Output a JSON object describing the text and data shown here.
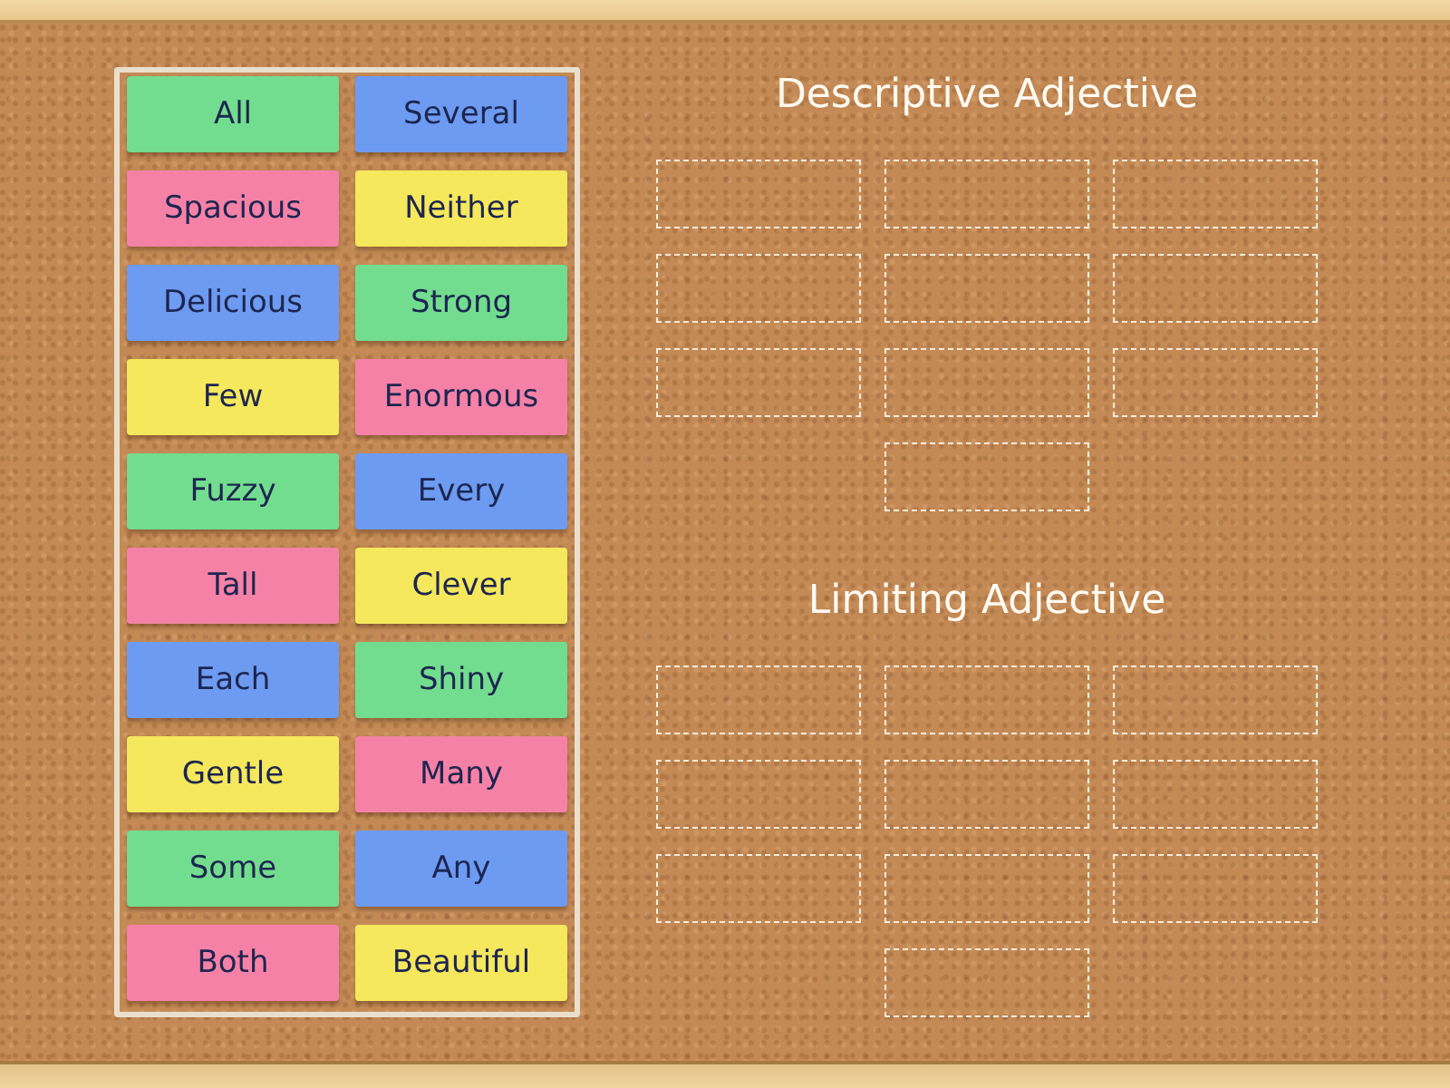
{
  "word_cards": [
    {
      "label": "All",
      "color": "#72dd8e"
    },
    {
      "label": "Several",
      "color": "#6d9bf1"
    },
    {
      "label": "Spacious",
      "color": "#f582a6"
    },
    {
      "label": "Neither",
      "color": "#f5e85c"
    },
    {
      "label": "Delicious",
      "color": "#6d9bf1"
    },
    {
      "label": "Strong",
      "color": "#72dd8e"
    },
    {
      "label": "Few",
      "color": "#f5e85c"
    },
    {
      "label": "Enormous",
      "color": "#f582a6"
    },
    {
      "label": "Fuzzy",
      "color": "#72dd8e"
    },
    {
      "label": "Every",
      "color": "#6d9bf1"
    },
    {
      "label": "Tall",
      "color": "#f582a6"
    },
    {
      "label": "Clever",
      "color": "#f5e85c"
    },
    {
      "label": "Each",
      "color": "#6d9bf1"
    },
    {
      "label": "Shiny",
      "color": "#72dd8e"
    },
    {
      "label": "Gentle",
      "color": "#f5e85c"
    },
    {
      "label": "Many",
      "color": "#f582a6"
    },
    {
      "label": "Some",
      "color": "#72dd8e"
    },
    {
      "label": "Any",
      "color": "#6d9bf1"
    },
    {
      "label": "Both",
      "color": "#f582a6"
    },
    {
      "label": "Beautiful",
      "color": "#f5e85c"
    }
  ],
  "groups": [
    {
      "title": "Descriptive Adjective",
      "slots": [
        {
          "kind": "empty"
        },
        {
          "kind": "empty"
        },
        {
          "kind": "empty"
        },
        {
          "kind": "empty"
        },
        {
          "kind": "empty"
        },
        {
          "kind": "empty"
        },
        {
          "kind": "empty"
        },
        {
          "kind": "empty"
        },
        {
          "kind": "empty"
        },
        {
          "kind": "empty"
        }
      ]
    },
    {
      "title": "Limiting Adjective",
      "slots": [
        {
          "kind": "empty"
        },
        {
          "kind": "empty"
        },
        {
          "kind": "empty"
        },
        {
          "kind": "empty"
        },
        {
          "kind": "empty"
        },
        {
          "kind": "empty"
        },
        {
          "kind": "empty"
        },
        {
          "kind": "empty"
        },
        {
          "kind": "empty"
        },
        {
          "kind": "empty"
        }
      ]
    }
  ]
}
